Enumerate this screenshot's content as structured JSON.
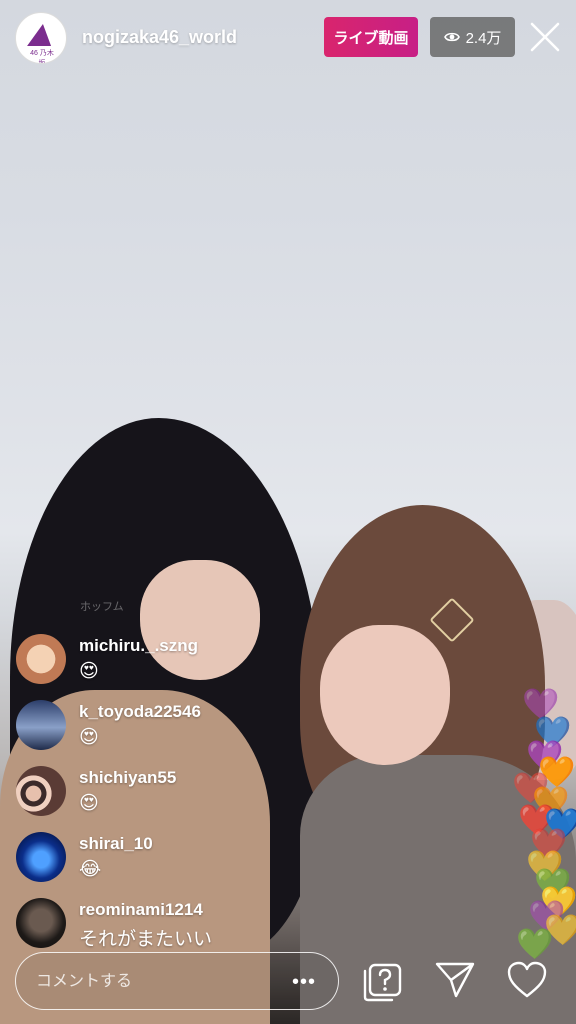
{
  "header": {
    "username": "nogizaka46_world",
    "live_label": "ライブ動画",
    "viewer_count": "2.4万",
    "avatar_mark": "46",
    "avatar_text": "乃木坂"
  },
  "faded_comment": "ホッフム",
  "comments": [
    {
      "user": "michiru._.szng",
      "text": "😍"
    },
    {
      "user": "k_toyoda22546",
      "text": "😍"
    },
    {
      "user": "shichiyan55",
      "text": "😍"
    },
    {
      "user": "shirai_10",
      "text": "😂"
    },
    {
      "user": "reominami1214",
      "text": "それがまたいい"
    }
  ],
  "bottom_bar": {
    "comment_placeholder": "コメントする",
    "more_label": "•••"
  },
  "hearts": [
    "💜",
    "💙",
    "💜",
    "🧡",
    "❤️",
    "🧡",
    "❤️",
    "💙",
    "❤️",
    "💛",
    "💚",
    "💛",
    "💜",
    "💛",
    "💚"
  ],
  "colors": {
    "live_badge": "#d9256d",
    "viewer_badge": "#5a5a5a"
  }
}
